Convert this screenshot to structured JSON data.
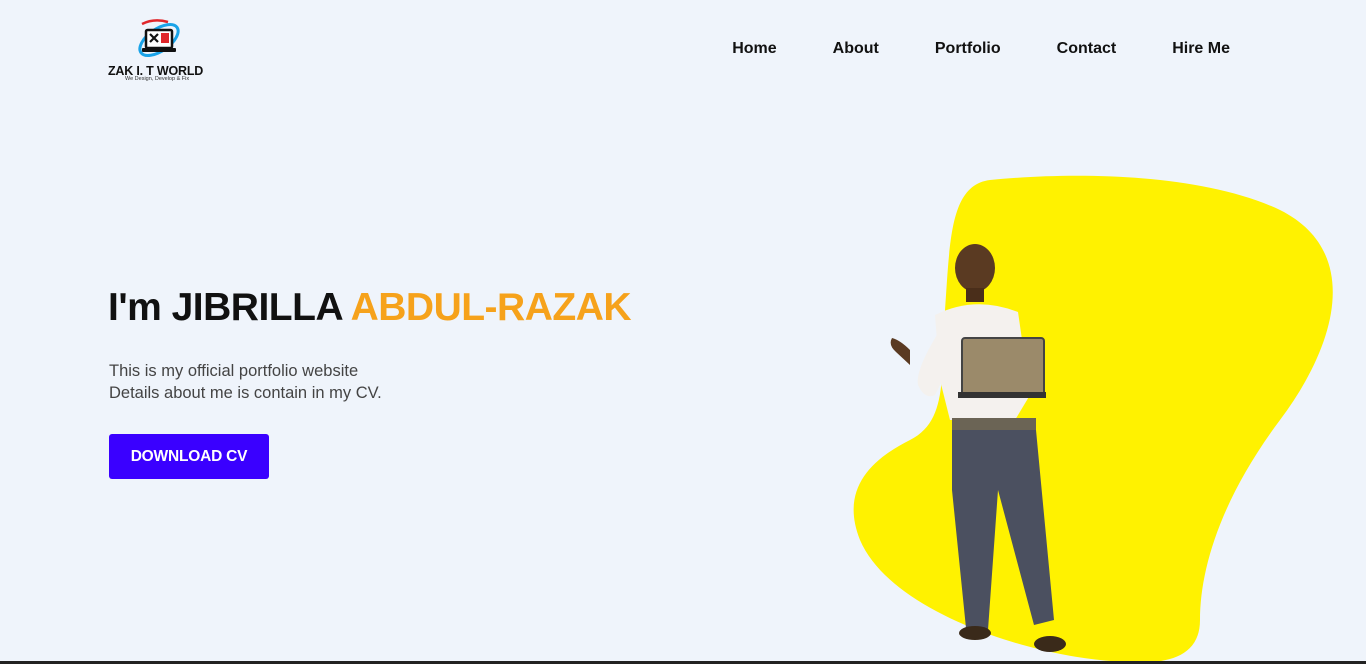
{
  "brand": {
    "name": "ZAK I. T WORLD",
    "tagline": "We Design, Develop & Fix"
  },
  "nav": {
    "items": [
      {
        "label": "Home"
      },
      {
        "label": "About"
      },
      {
        "label": "Portfolio"
      },
      {
        "label": "Contact"
      },
      {
        "label": "Hire Me"
      }
    ]
  },
  "hero": {
    "title_prefix": "I'm JIBRILLA ",
    "title_highlight": "ABDUL-RAZAK",
    "description_line1": "This is my official portfolio website",
    "description_line2": "Details about me is contain in my CV.",
    "cta_label": "DOWNLOAD CV"
  },
  "colors": {
    "background": "#eff4fb",
    "accent_name": "#f6a21b",
    "button": "#3a00ff",
    "blob": "#fff200"
  },
  "icons": {
    "logo": "laptop-tools-logo-icon",
    "portrait": "person-with-laptop-photo"
  }
}
